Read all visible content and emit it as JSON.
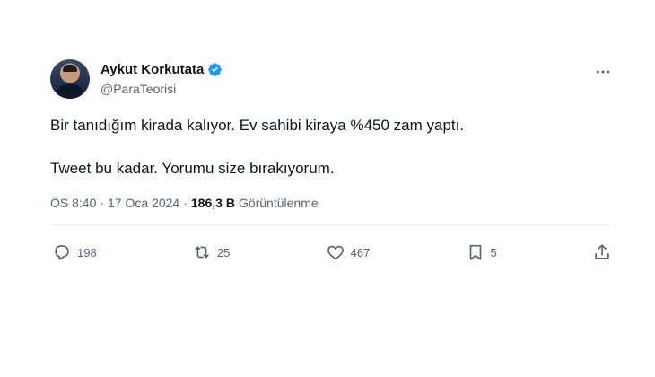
{
  "author": {
    "display_name": "Aykut Korkutata",
    "handle": "@ParaTeorisi",
    "verified": true
  },
  "tweet": {
    "line1": "Bir tanıdığım kirada kalıyor. Ev sahibi kiraya %450 zam yaptı.",
    "line2": "Tweet bu kadar. Yorumu size bırakıyorum."
  },
  "meta": {
    "time": "ÖS 8:40",
    "separator": "·",
    "date": "17 Oca 2024",
    "views_count": "186,3 B",
    "views_label": "Görüntülenme"
  },
  "actions": {
    "replies": "198",
    "reposts": "25",
    "likes": "467",
    "bookmarks": "5"
  },
  "colors": {
    "verified": "#1d9bf0",
    "text_primary": "#0f1419",
    "text_secondary": "#536471",
    "divider": "#eff3f4"
  },
  "icons": [
    "verified-badge-icon",
    "more-icon",
    "reply-icon",
    "repost-icon",
    "like-icon",
    "bookmark-icon",
    "share-icon"
  ]
}
